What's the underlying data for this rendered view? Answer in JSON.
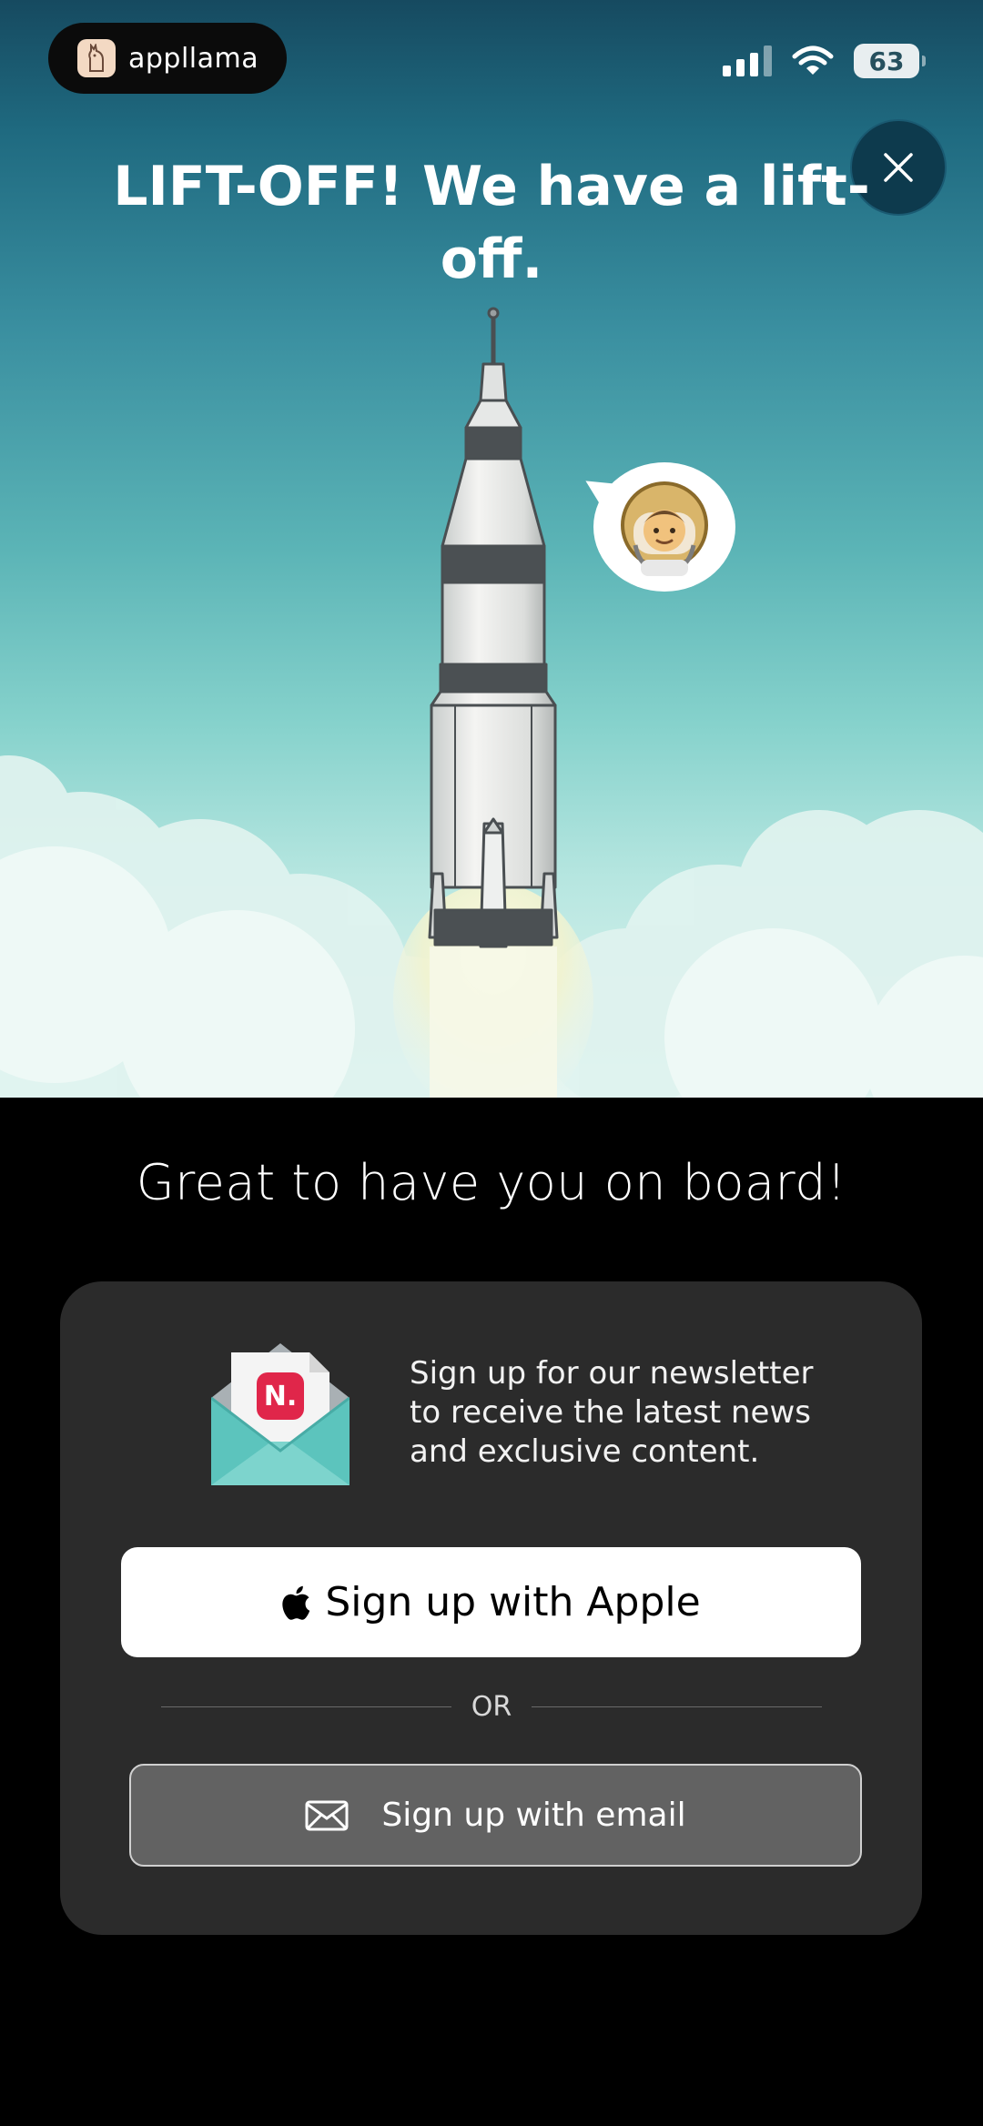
{
  "status_bar": {
    "app_name": "appllama",
    "battery_level": "63",
    "icons": [
      "app-logo-icon",
      "cellular-signal-icon",
      "wifi-icon",
      "battery-icon"
    ]
  },
  "hero": {
    "title": "LIFT-OFF! We have a lift-off.",
    "close_icon": "close-icon",
    "illustration": "rocket-launch",
    "bubble_emoji": "👨‍🚀"
  },
  "main": {
    "welcome": "Great to have you on board!",
    "newsletter": {
      "icon": "newsletter-envelope-icon",
      "badge": "N.",
      "text": "Sign up for our newsletter to receive the latest news and exclusive content."
    },
    "apple_button": {
      "label": "Sign up with Apple",
      "icon": "apple-icon"
    },
    "divider_label": "OR",
    "email_button": {
      "label": "Sign up with email",
      "icon": "mail-icon"
    }
  },
  "colors": {
    "sky_top": "#164a60",
    "sky_bottom": "#e6f6f2",
    "card_bg": "#2b2b2b",
    "email_button_bg": "#626262",
    "close_button_bg": "#0d3a4d",
    "badge_red": "#e0264a",
    "envelope_teal": "#5cc4bd"
  }
}
